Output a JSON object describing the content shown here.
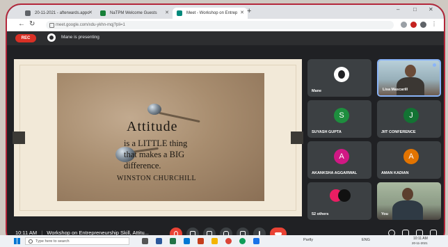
{
  "browser": {
    "tabs": [
      {
        "label": "20-11-2021 - afterwards.appo",
        "color": "#5f6368"
      },
      {
        "label": "NaTPM Welcome Guests",
        "color": "#188038"
      },
      {
        "label": "Meet - Workshop on Entrep",
        "color": "#00897b"
      }
    ],
    "url": "meet.google.com/xdu-ykhn-mqj?pli=1"
  },
  "meet": {
    "rec_label": "REC",
    "presenting_text": "Mane is presenting",
    "slide": {
      "title": "Attitude",
      "line1": "is a LITTLE thing",
      "line2": "that makes a BIG",
      "line3": "difference.",
      "author": "WINSTON CHURCHILL"
    },
    "tiles": [
      {
        "name": "Mane",
        "type": "avatar-icon",
        "color": "#ffffff"
      },
      {
        "name": "Lisa Mascarill",
        "type": "video"
      },
      {
        "name": "SUYASH GUPTA",
        "initial": "S",
        "color": "#1e8e3e"
      },
      {
        "name": "JIIT CONFERENCE",
        "initial": "J",
        "color": "#137333"
      },
      {
        "name": "AKANKSHA AGGARWAL",
        "initial": "A",
        "color": "#d01884"
      },
      {
        "name": "AMAN KADIAN",
        "initial": "A",
        "color": "#e37400"
      },
      {
        "name": "52 others",
        "type": "others"
      },
      {
        "name": "You",
        "type": "video"
      }
    ],
    "bottom": {
      "time": "10:11 AM",
      "meeting_title": "Workshop on Entrepreneurship Skill, Attitu..."
    }
  },
  "taskbar": {
    "search_placeholder": "Type here to search",
    "weather": "Partly",
    "tray_lang": "ENG",
    "clock_time": "10:11 AM",
    "clock_date": "20-11-2021"
  }
}
